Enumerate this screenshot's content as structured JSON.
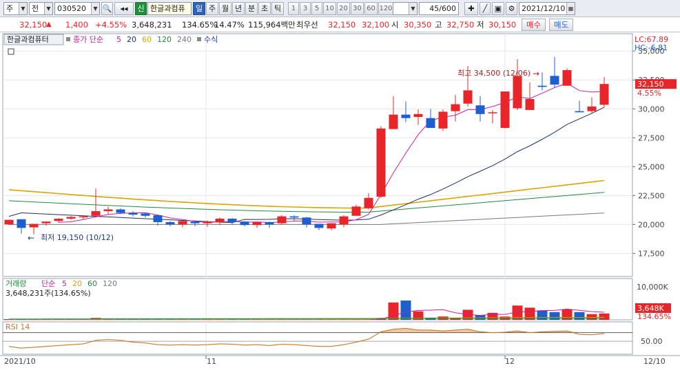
{
  "toolbar": {
    "market": "주",
    "type": "전",
    "code": "030520",
    "name": "한글과컴퓨",
    "sin": "신",
    "periods": [
      "일",
      "주",
      "월",
      "년",
      "분",
      "초",
      "틱"
    ],
    "ticks": [
      "1",
      "3",
      "5",
      "10",
      "20",
      "30",
      "60",
      "120"
    ],
    "count": "45/600",
    "date": "2021/12/10"
  },
  "quote": {
    "price": "32,150",
    "arrow": "▲",
    "change": "1,400",
    "pct": "+4.55%",
    "volume": "3,648,231",
    "vol_pct": "134.65%",
    "turnover": "14.47%",
    "amount": "115,964백만",
    "bid_label": "최우선",
    "bid1": "32,150",
    "bid2": "32,100",
    "open_label": "시",
    "open": "30,350",
    "high_label": "고",
    "high": "32,750",
    "low_label": "저",
    "low": "30,150",
    "buy": "매수",
    "sell": "매도"
  },
  "panel": {
    "title": "한글과컴퓨터",
    "legend_name": "종가 단순",
    "ma_periods": [
      "5",
      "20",
      "60",
      "120",
      "240"
    ],
    "formula": "수식",
    "lc": "LC:67.89",
    "hc": "HC:-6.81",
    "hi_annot": "최고 34,500 (12/06)",
    "lo_annot": "최저 19,150 (10/12)",
    "price_tag": "32,150",
    "pct_tag": "4.55%",
    "vol_title": "거래량",
    "vol_legend": "단순",
    "vol_periods": [
      "5",
      "20",
      "60",
      "120"
    ],
    "vol_value": "3,648,231주(134.65%)",
    "vol_tag": "3,648K",
    "vol_pct_tag": "134.65%",
    "rsi_title": "RSI 14",
    "rsi_axis": "50.00",
    "x_labels": [
      "2021/10",
      "11",
      "12",
      "12/10"
    ],
    "y_labels": [
      "35,000",
      "32,500",
      "30,000",
      "27,500",
      "25,000",
      "22,500",
      "20,000",
      "17,500"
    ],
    "vol_axis": "10,000K"
  },
  "colors": {
    "up": "#e8262a",
    "down": "#1e5fd0",
    "ma5": "#cc1e9e",
    "ma20": "#1c2f66",
    "ma60": "#d9a400",
    "ma120": "#1e8a3a",
    "ma240": "#777777"
  },
  "chart_data": {
    "type": "candlestick",
    "dates": [
      "10/01",
      "10/05",
      "10/06",
      "10/07",
      "10/08",
      "10/12",
      "10/13",
      "10/14",
      "10/15",
      "10/18",
      "10/19",
      "10/20",
      "10/21",
      "10/22",
      "10/25",
      "10/26",
      "10/27",
      "10/28",
      "10/29",
      "11/01",
      "11/02",
      "11/03",
      "11/04",
      "11/05",
      "11/08",
      "11/09",
      "11/10",
      "11/11",
      "11/12",
      "11/15",
      "11/16",
      "11/17",
      "11/18",
      "11/19",
      "11/22",
      "11/23",
      "11/24",
      "11/25",
      "11/26",
      "11/29",
      "11/30",
      "12/01",
      "12/02",
      "12/03",
      "12/06",
      "12/07",
      "12/08",
      "12/09",
      "12/10"
    ],
    "open": [
      20000,
      20450,
      19750,
      20100,
      20300,
      20500,
      20700,
      20750,
      21150,
      21300,
      21000,
      20950,
      20800,
      20200,
      20000,
      20250,
      20100,
      20200,
      20500,
      20250,
      19950,
      20200,
      20100,
      20700,
      20600,
      20050,
      19650,
      20000,
      20750,
      21400,
      22400,
      28250,
      29500,
      29300,
      29200,
      28300,
      29800,
      30450,
      30300,
      29650,
      28350,
      30050,
      29900,
      32000,
      32850,
      32000,
      29800,
      29800,
      30350
    ],
    "close": [
      20400,
      19700,
      20050,
      20250,
      20500,
      20650,
      20700,
      21150,
      21300,
      21000,
      20850,
      20750,
      20200,
      20000,
      20300,
      20100,
      20250,
      20500,
      20200,
      19950,
      20200,
      20000,
      20700,
      20600,
      20000,
      19700,
      20100,
      20700,
      21550,
      22300,
      28300,
      29500,
      29200,
      29550,
      28350,
      29750,
      30400,
      31600,
      29550,
      29700,
      31500,
      32850,
      30850,
      31900,
      32100,
      33350,
      29700,
      30200,
      32150
    ],
    "high": [
      20400,
      20450,
      20050,
      20250,
      20550,
      20750,
      20800,
      23100,
      21550,
      21400,
      21150,
      21050,
      20800,
      20300,
      20300,
      20300,
      20350,
      20600,
      20550,
      20300,
      20100,
      20250,
      20800,
      20800,
      20650,
      20050,
      20100,
      20800,
      21700,
      22700,
      28500,
      31100,
      30650,
      29950,
      30000,
      29950,
      31200,
      33700,
      31100,
      29900,
      31500,
      34300,
      32300,
      33150,
      34500,
      33500,
      30700,
      31000,
      32750
    ],
    "low": [
      19950,
      19200,
      19150,
      19900,
      20150,
      20400,
      20400,
      20700,
      20900,
      20900,
      20700,
      20600,
      19900,
      19850,
      19750,
      19850,
      19800,
      19950,
      20000,
      19850,
      19700,
      19700,
      20000,
      20300,
      19750,
      19500,
      19500,
      19750,
      20750,
      21300,
      22300,
      28250,
      28850,
      28600,
      28950,
      28100,
      28900,
      30200,
      28900,
      28750,
      28300,
      29900,
      30150,
      31600,
      31800,
      32000,
      29700,
      29600,
      30150
    ],
    "volume": [
      180,
      150,
      140,
      130,
      140,
      130,
      170,
      480,
      260,
      180,
      170,
      160,
      170,
      160,
      150,
      340,
      150,
      160,
      170,
      150,
      160,
      160,
      170,
      150,
      150,
      160,
      150,
      150,
      160,
      170,
      280,
      4500,
      5000,
      2200,
      570,
      860,
      530,
      2600,
      1200,
      1800,
      850,
      3700,
      3150,
      2450,
      2000,
      2700,
      2000,
      1470,
      1640
    ],
    "rsi": [
      38,
      34,
      36,
      38,
      40,
      42,
      44,
      52,
      54,
      52,
      48,
      46,
      42,
      41,
      42,
      41,
      42,
      44,
      43,
      41,
      42,
      40,
      43,
      42,
      40,
      38,
      38,
      42,
      48,
      55,
      72,
      78,
      80,
      76,
      76,
      74,
      76,
      78,
      72,
      70,
      71,
      74,
      70,
      72,
      73,
      74,
      66,
      65,
      68
    ],
    "ma20_start": [
      20700,
      21000
    ],
    "ylim": [
      15500,
      36500
    ],
    "vol_ylim": [
      0,
      10000
    ],
    "rsi_ylim": [
      20,
      95
    ]
  }
}
